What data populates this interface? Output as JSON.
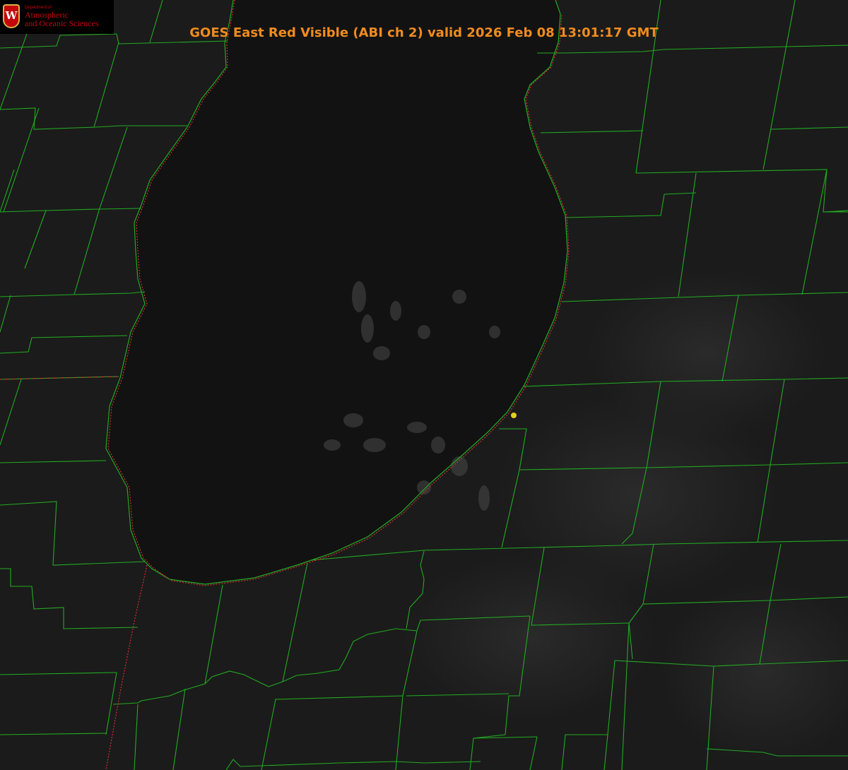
{
  "title": "GOES East Red Visible (ABI ch 2) valid 2026 Feb 08 13:01:17 GMT",
  "logo": {
    "crest_letter": "W",
    "department": "Department of",
    "name_line1": "Atmospheric",
    "name_line2": "and Oceanic Sciences"
  },
  "colors": {
    "title": "#f08c1e",
    "county_lines": "#22aa22",
    "state_line": "#dd3333",
    "marker": "#e0d020",
    "land": "#1b1b1b",
    "lake": "#121212",
    "logo_text": "#c5050c"
  },
  "map": {
    "imagery": "satellite-visible",
    "feature": "lake-outline",
    "marker": "yellow-dot-location-marker"
  }
}
